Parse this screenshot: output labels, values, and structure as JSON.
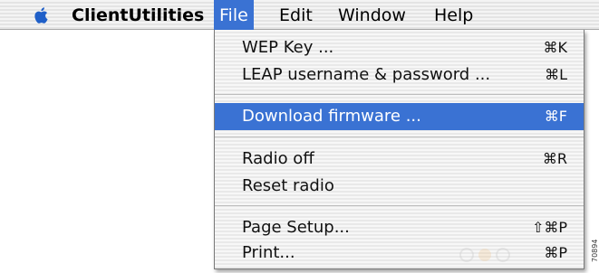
{
  "menubar": {
    "apple_icon": "apple-logo",
    "app_name": "ClientUtilities",
    "menus": [
      "File",
      "Edit",
      "Window",
      "Help"
    ],
    "active_menu": "File",
    "highlight_color": "#3a72d3"
  },
  "file_menu": {
    "items": [
      {
        "label": "WEP Key ...",
        "shortcut": "⌘K"
      },
      {
        "label": "LEAP username & password ...",
        "shortcut": "⌘L"
      },
      {
        "label": "Download firmware ...",
        "shortcut": "⌘F",
        "highlighted": true
      },
      {
        "label": "Radio off",
        "shortcut": "⌘R"
      },
      {
        "label": "Reset radio",
        "shortcut": ""
      },
      {
        "label": "Page Setup...",
        "shortcut": "⇧⌘P"
      },
      {
        "label": "Print...",
        "shortcut": "⌘P"
      }
    ]
  },
  "figure_code": "70894"
}
